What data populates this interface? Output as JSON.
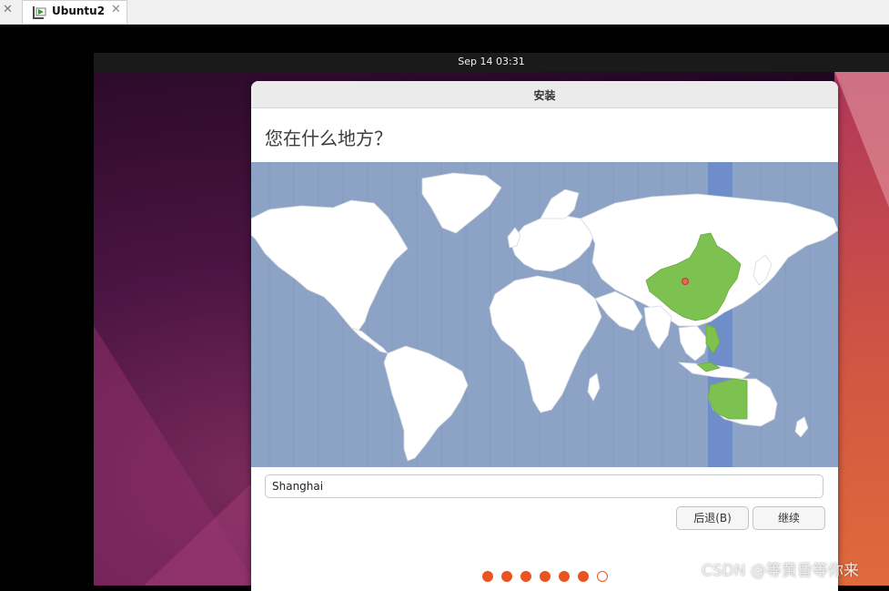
{
  "host": {
    "tab_label": "Ubuntu2",
    "close_glyph": "✕"
  },
  "vm": {
    "clock": "Sep 14  03:31"
  },
  "installer": {
    "window_title": "安装",
    "question": "您在什么地方？",
    "timezone_value": "Shanghai",
    "back_label": "后退(B)",
    "continue_label": "继续",
    "progress": {
      "total_steps": 7,
      "completed_steps": 6
    }
  },
  "colors": {
    "ocean": "#8da3c6",
    "land": "#ffffff",
    "selected_region": "#7dc150",
    "timezone_band": "#6f8dc8",
    "accent": "#e95420"
  },
  "watermark": "CSDN @等黄昏等你来"
}
